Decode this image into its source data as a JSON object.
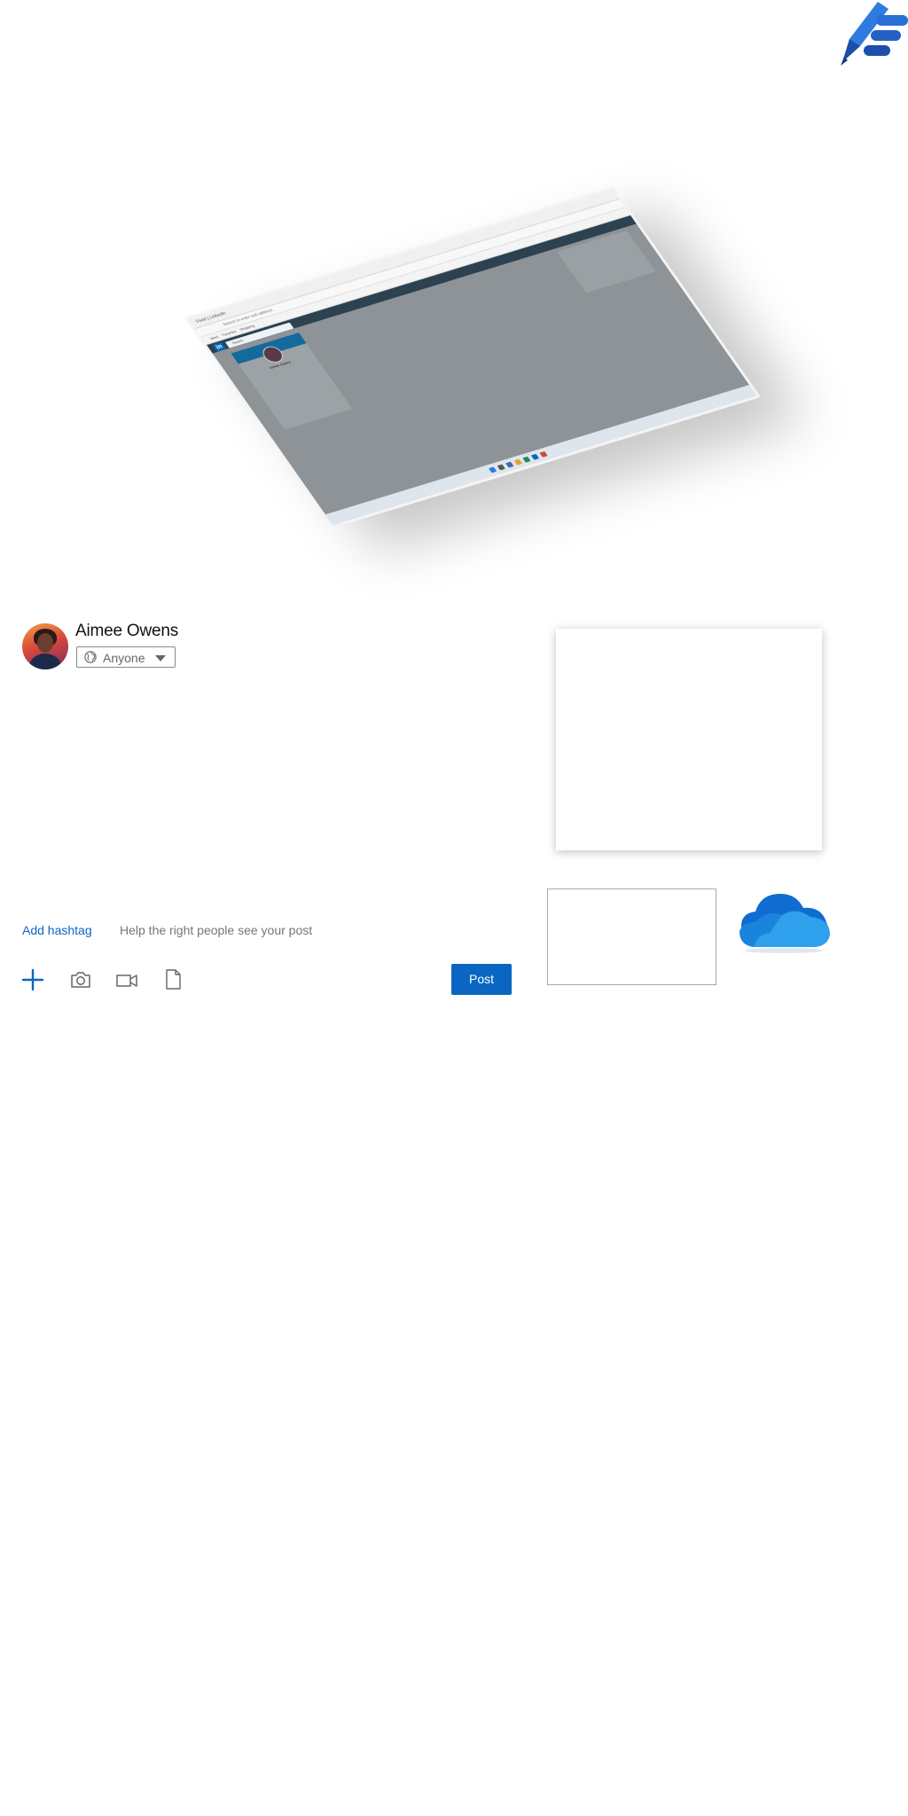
{
  "composer": {
    "author_name": "Aimee Owens",
    "visibility": "Anyone",
    "add_hashtag_label": "Add hashtag",
    "hashtag_help": "Help the right people see your post",
    "post_label": "Post",
    "tools": [
      "plus-icon",
      "camera-icon",
      "video-icon",
      "document-icon"
    ]
  },
  "preview": {
    "browser_tab": "Feed | LinkedIn",
    "address": "Search or enter web address",
    "favorites": [
      "Work",
      "Favorites",
      "Shopping"
    ],
    "site_logo": "in",
    "search_placeholder": "Search",
    "profile_name": "Aimee Owens"
  },
  "colors": {
    "accent": "#0a66c2",
    "linkedin_nav": "#2c4250",
    "onedrive_blue": "#1e8fe0"
  },
  "icons": {
    "top_logo": "pen-logo",
    "cloud": "onedrive-logo",
    "visibility": "globe-icon"
  }
}
